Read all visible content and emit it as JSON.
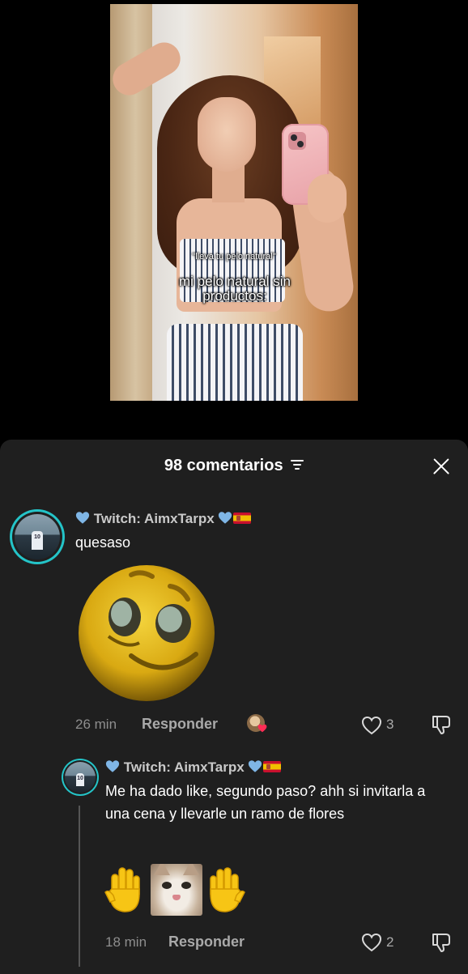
{
  "video": {
    "caption_small": "\"lleva tu pelo natural\"",
    "caption_large": "mi pelo natural sin productos:"
  },
  "comments_header": {
    "count_label": "98 comentarios"
  },
  "comments": [
    {
      "username": "Twitch: AimxTarpx",
      "text": "quesaso",
      "time": "26 min",
      "reply_label": "Responder",
      "likes": "3"
    },
    {
      "username": "Twitch: AimxTarpx",
      "text": "Me ha dado like, segundo paso? ahh si invitarla a una cena y llevarle un ramo de flores",
      "time": "18 min",
      "reply_label": "Responder",
      "likes": "2"
    }
  ],
  "colors": {
    "sheet_background": "#1f1f1f",
    "avatar_ring": "#24c4c8",
    "heart_blue": "#7fb6e6",
    "creator_like_heart": "#fe2c55"
  },
  "icons": [
    "filter-icon",
    "close-icon",
    "blue-heart-icon",
    "spain-flag-icon",
    "like-heart-icon",
    "dislike-icon",
    "raised-hand-icon"
  ]
}
